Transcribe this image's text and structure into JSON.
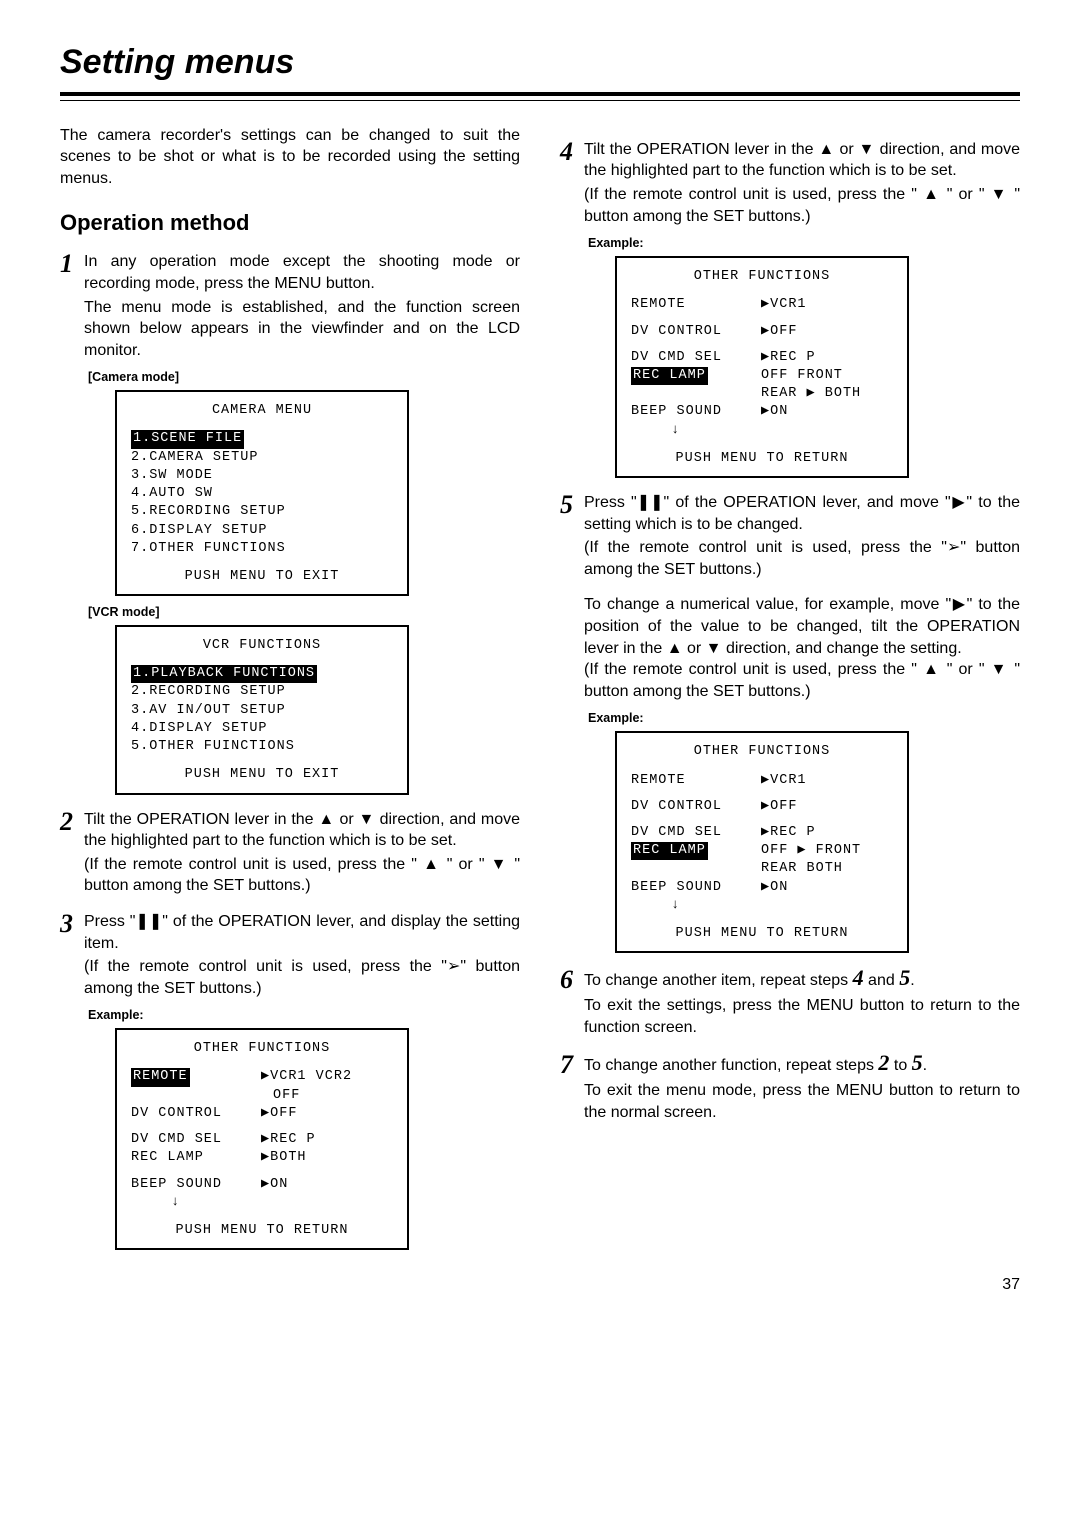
{
  "title": "Setting menus",
  "intro": "The camera recorder's settings can be changed to suit the scenes to be shot or what is to be recorded using the setting menus.",
  "opMethod": "Operation method",
  "steps": {
    "s1": "In any operation mode except the shooting mode or recording mode, press the MENU button.",
    "s1b": "The menu mode is established, and the function screen shown below appears in the viewfinder and on the LCD monitor.",
    "s2": "Tilt the OPERATION lever in the ▲ or ▼ direction, and move the highlighted part to the function which is to be set.",
    "s2b": "(If the remote control unit is used, press the \" ▲ \" or \" ▼ \" button among the SET buttons.)",
    "s3": "Press \"❚❚\" of the OPERATION lever, and display the setting item.",
    "s3b": "(If the remote control unit is used, press the \"➢\" button among the SET buttons.)",
    "s4": "Tilt the OPERATION lever in the ▲ or ▼ direction, and move the highlighted part to the function which is to be set.",
    "s4b": "(If the remote control unit is used, press the \" ▲ \" or \" ▼ \" button among the SET buttons.)",
    "s5": "Press \"❚❚\" of the OPERATION lever, and move \"▶\" to the setting which is to be changed.",
    "s5b": "(If the remote control unit is used, press the \"➢\" button among the SET buttons.)",
    "s5c": "To change a numerical value, for example, move \"▶\" to the position of the value to be changed, tilt the OPERATION lever in the ▲ or ▼ direction, and change the setting.",
    "s5d": "(If the remote control unit is used, press the \" ▲ \" or \" ▼ \" button among the SET buttons.)",
    "s6a": "To change another item, repeat steps ",
    "s6b": " and ",
    "s6end": ".",
    "s6c": "To exit the settings, press the MENU button to return to the function screen.",
    "s7a": "To change another function, repeat steps ",
    "s7b": " to ",
    "s7end": ".",
    "s7c": "To exit the menu mode, press the MENU button to return to the normal screen."
  },
  "labels": {
    "cameraMode": "[Camera mode]",
    "vcrMode": "[VCR mode]",
    "example": "Example:"
  },
  "cameraMenu": {
    "title": "CAMERA MENU",
    "items": [
      "1.SCENE FILE",
      "2.CAMERA SETUP",
      "3.SW MODE",
      "4.AUTO SW",
      "5.RECORDING SETUP",
      "6.DISPLAY SETUP",
      "7.OTHER FUNCTIONS"
    ],
    "footer": "PUSH MENU TO EXIT"
  },
  "vcrMenu": {
    "title": "VCR FUNCTIONS",
    "items": [
      "1.PLAYBACK FUNCTIONS",
      "2.RECORDING SETUP",
      "3.AV IN/OUT SETUP",
      "4.DISPLAY SETUP",
      "5.OTHER FUINCTIONS"
    ],
    "footer": "PUSH MENU TO EXIT"
  },
  "otherA": {
    "title": "OTHER FUNCTIONS",
    "remote": "REMOTE",
    "remote_v": "▶VCR1  VCR2",
    "remote_v2": "OFF",
    "dvctrl": "DV CONTROL",
    "dvctrl_v": "▶OFF",
    "dvcmd": "DV CMD SEL",
    "dvcmd_v": "▶REC P",
    "reclamp": "REC LAMP",
    "reclamp_v": "▶BOTH",
    "beep": "BEEP SOUND",
    "beep_v": "▶ON",
    "arrow": "↓",
    "footer": "PUSH MENU TO RETURN"
  },
  "otherB": {
    "title": "OTHER FUNCTIONS",
    "remote": "REMOTE",
    "remote_v": "▶VCR1",
    "dvctrl": "DV CONTROL",
    "dvctrl_v": "▶OFF",
    "dvcmd": "DV CMD SEL",
    "dvcmd_v": "▶REC P",
    "reclamp": "REC LAMP",
    "line2l": " OFF    FRONT",
    "line2r": " REAR ▶ BOTH",
    "beep": "BEEP SOUND",
    "beep_v": "▶ON",
    "arrow": "↓",
    "footer": "PUSH MENU TO RETURN"
  },
  "otherC": {
    "title": "OTHER FUNCTIONS",
    "remote": "REMOTE",
    "remote_v": "▶VCR1",
    "dvctrl": "DV CONTROL",
    "dvctrl_v": "▶OFF",
    "dvcmd": "DV CMD SEL",
    "dvcmd_v": "▶REC P",
    "reclamp": "REC LAMP",
    "line2l": " OFF  ▶ FRONT",
    "line2r": " REAR   BOTH",
    "beep": "BEEP SOUND",
    "beep_v": "▶ON",
    "arrow": "↓",
    "footer": "PUSH MENU TO RETURN"
  },
  "pageNumber": "37"
}
